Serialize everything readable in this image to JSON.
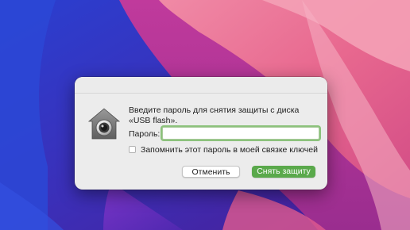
{
  "dialog": {
    "message_line1": "Введите пароль для снятия защиты с диска",
    "message_line2": "«USB flash».",
    "password_label": "Пароль:",
    "password_value": "",
    "remember_label": "Запомнить этот пароль в моей связке ключей",
    "remember_checked": false,
    "cancel_label": "Отменить",
    "unlock_label": "Снять защиту",
    "icon": "lock-gatekeeper-icon"
  },
  "colors": {
    "accent": "#5aa94b",
    "focus_ring": "#8cc27c",
    "dialog_bg": "#ececec"
  }
}
